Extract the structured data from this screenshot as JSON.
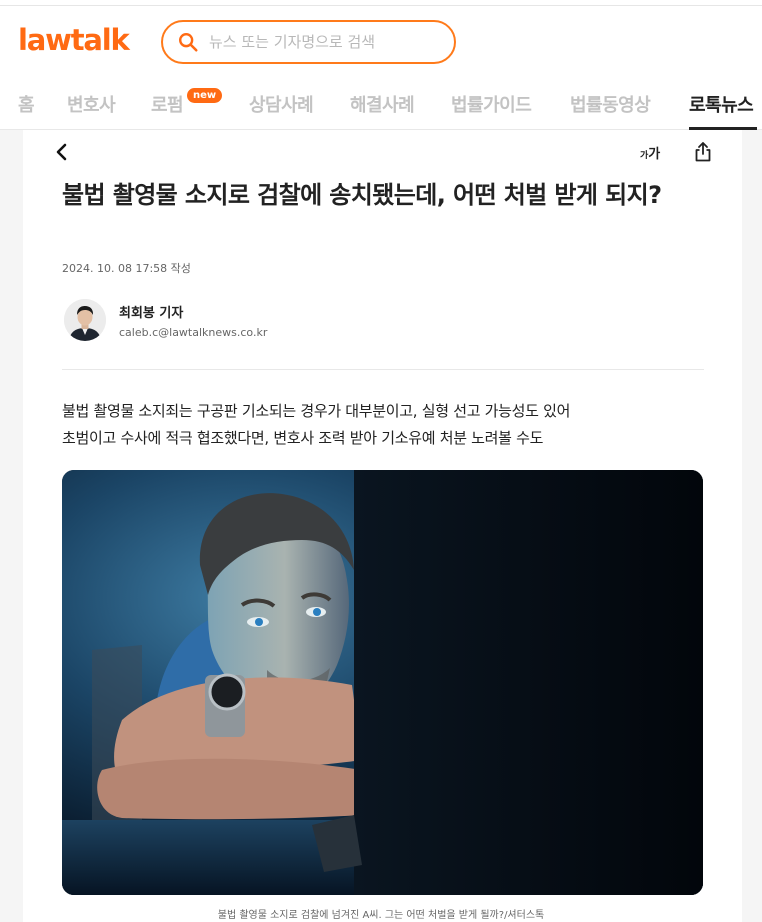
{
  "brand": {
    "logo_text": "lawtalk",
    "accent_color": "#ff6a13"
  },
  "search": {
    "placeholder": "뉴스 또는 기자명으로 검색",
    "value": ""
  },
  "nav": {
    "items": [
      {
        "label": "홈",
        "active": false
      },
      {
        "label": "변호사",
        "active": false
      },
      {
        "label": "로펌",
        "active": false,
        "badge": "new"
      },
      {
        "label": "상담사례",
        "active": false
      },
      {
        "label": "해결사례",
        "active": false
      },
      {
        "label": "법률가이드",
        "active": false
      },
      {
        "label": "법률동영상",
        "active": false
      },
      {
        "label": "로톡뉴스",
        "active": true
      }
    ]
  },
  "toolbar": {
    "back_icon": "chevron-left-icon",
    "font_size_large": "가",
    "font_size_small": "가",
    "share_icon": "share-icon"
  },
  "article": {
    "title": "불법 촬영물 소지로 검찰에 송치됐는데, 어떤 처벌 받게 되지?",
    "date": "2024. 10. 08 17:58 작성",
    "author": {
      "name": "최회봉 기자",
      "email": "caleb.c@lawtalknews.co.kr"
    },
    "summary": [
      "불법 촬영물 소지죄는 구공판 기소되는 경우가 대부분이고, 실형 선고 가능성도 있어",
      "초범이고 수사에 적극 협조했다면, 변호사 조력 받아 기소유예 처분 노려볼 수도"
    ],
    "image_caption": "불법 촬영물 소지로 검찰에 넘겨진 A씨. 그는 어떤 처벌을 받게 될까?/셔터스톡"
  }
}
